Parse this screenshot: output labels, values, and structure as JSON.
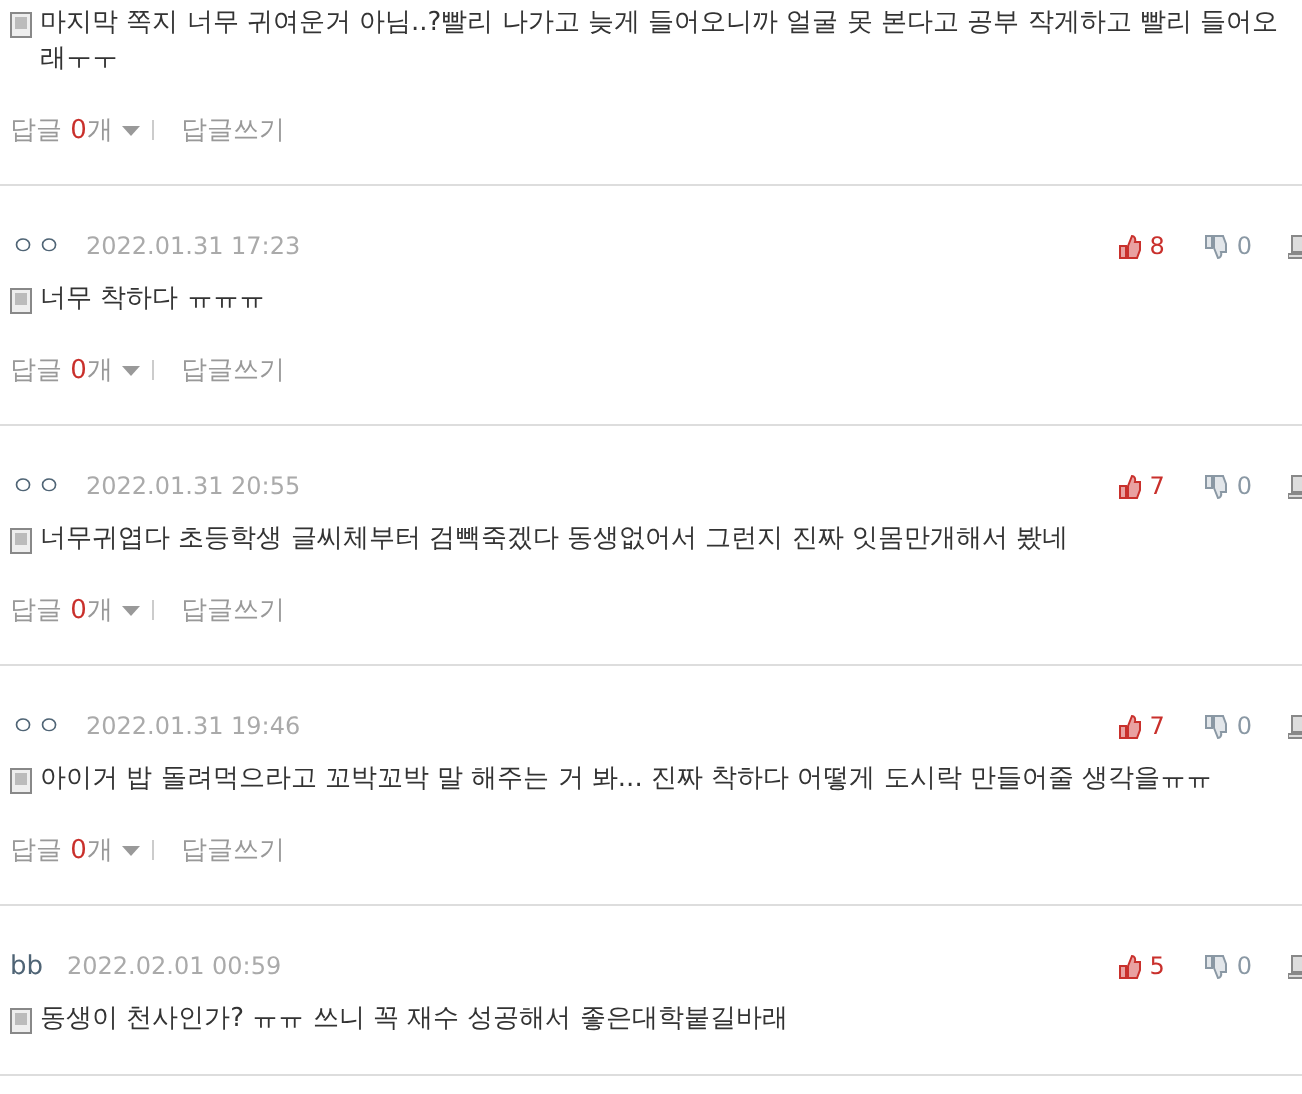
{
  "comments": [
    {
      "text": "마지막 쪽지 너무 귀여운거 아님..?빨리 나가고 늦게 들어오니까 얼굴 못 본다고 공부 작게하고 빨리 들어오래ㅜㅜ",
      "reply_label": "답글",
      "reply_count": "0",
      "reply_unit": "개",
      "write_label": "답글쓰기"
    },
    {
      "author": "ㅇㅇ",
      "date": "2022.01.31 17:23",
      "likes": "8",
      "dislikes": "0",
      "text": "너무 착하다 ㅠㅠㅠ",
      "reply_label": "답글",
      "reply_count": "0",
      "reply_unit": "개",
      "write_label": "답글쓰기"
    },
    {
      "author": "ㅇㅇ",
      "date": "2022.01.31 20:55",
      "likes": "7",
      "dislikes": "0",
      "text": "너무귀엽다 초등학생 글씨체부터 검빽죽겠다 동생없어서 그런지 진짜 잇몸만개해서 봤네",
      "reply_label": "답글",
      "reply_count": "0",
      "reply_unit": "개",
      "write_label": "답글쓰기"
    },
    {
      "author": "ㅇㅇ",
      "date": "2022.01.31 19:46",
      "likes": "7",
      "dislikes": "0",
      "text": "아이거 밥 돌려먹으라고 꼬박꼬박 말 해주는 거 봐... 진짜 착하다 어떻게 도시락 만들어줄 생각을ㅠㅠ",
      "reply_label": "답글",
      "reply_count": "0",
      "reply_unit": "개",
      "write_label": "답글쓰기"
    },
    {
      "author": "bb",
      "date": "2022.02.01 00:59",
      "likes": "5",
      "dislikes": "0",
      "text": "동생이 천사인가? ㅠㅠ 쓰니 꼭 재수 성공해서 좋은대학붙길바래"
    }
  ]
}
